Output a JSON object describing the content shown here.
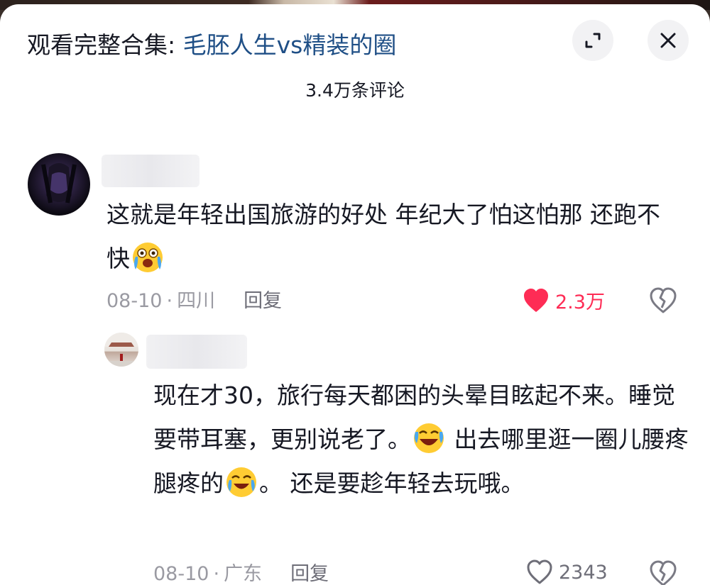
{
  "header": {
    "title_prefix": "观看完整合集: ",
    "series_name": "毛胚人生vs精装的圈",
    "comment_count": "3.4万条评论"
  },
  "comments": [
    {
      "text_before_emoji": "这就是年轻出国旅游的好处 年纪大了怕这怕那 还跑不快",
      "text_after_emoji": "",
      "date": "08-10",
      "separator": "·",
      "location": "四川",
      "reply_label": "回复",
      "like_count": "2.3万",
      "liked": true
    },
    {
      "text_part1": "现在才30，旅行每天都困的头晕目眩起不来。睡觉要带耳塞，更别说老了。",
      "text_part2": " 出去哪里逛一圈儿腰疼腿疼的",
      "text_part3": "。   还是要趁年轻去玩哦。",
      "date": "08-10",
      "separator": "·",
      "location": "广东",
      "reply_label": "回复",
      "like_count": "2343",
      "liked": false
    }
  ],
  "colors": {
    "accent_red": "#fe2c55",
    "link_blue": "#1f4f86",
    "meta_gray": "#9a9aa2"
  },
  "icons": [
    "expand-icon",
    "close-icon",
    "heart-filled-icon",
    "heart-outline-icon",
    "broken-heart-icon",
    "crying-emoji-icon",
    "laughing-tears-emoji-icon"
  ]
}
